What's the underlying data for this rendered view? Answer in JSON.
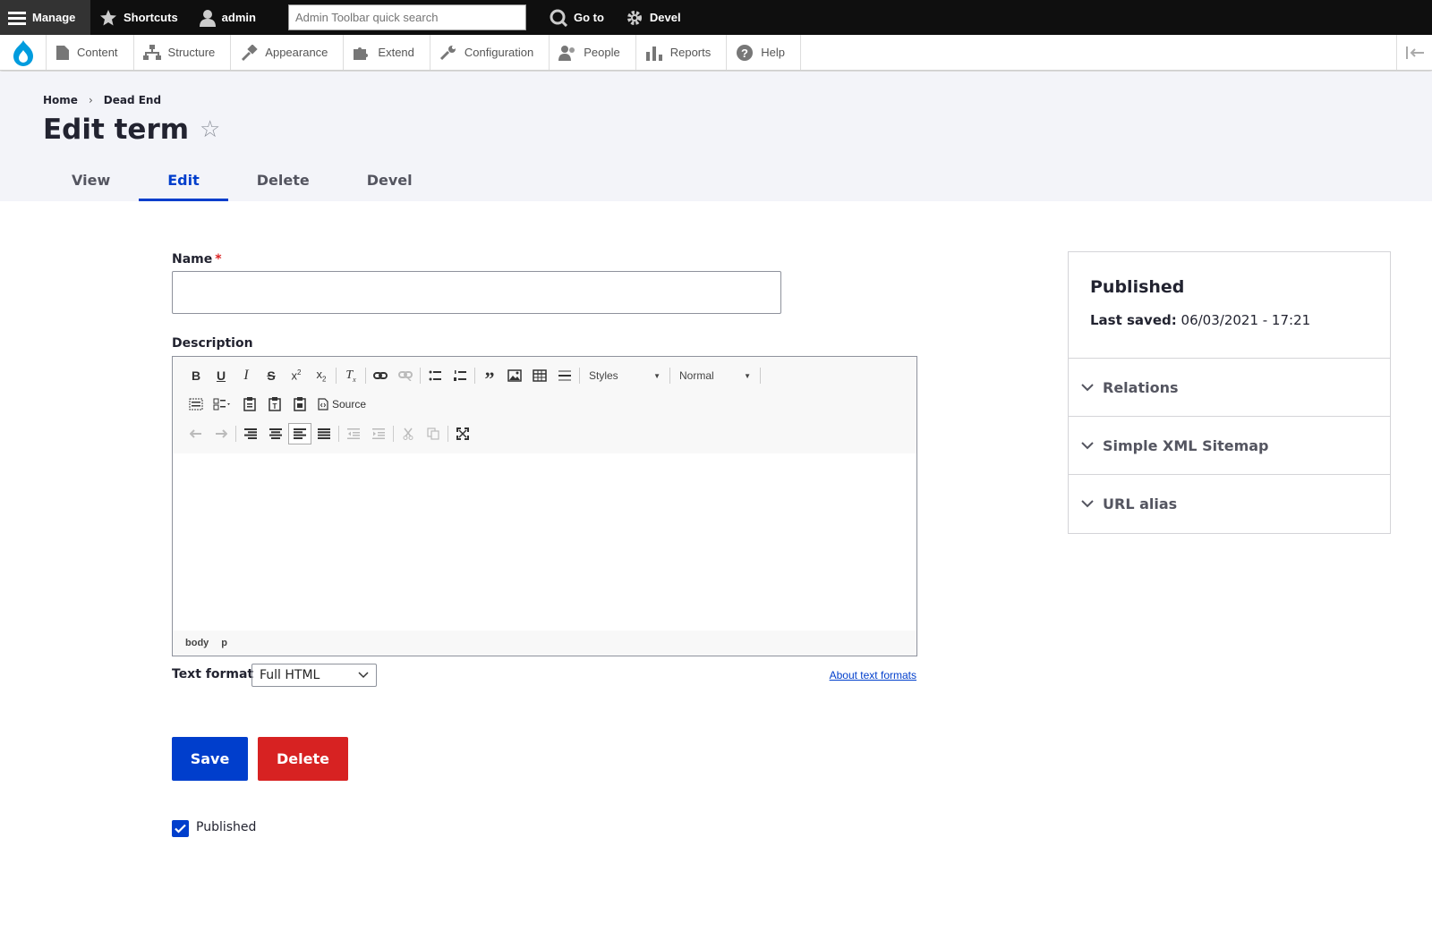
{
  "toolbar": {
    "manage_label": "Manage",
    "shortcuts_label": "Shortcuts",
    "user_label": "admin",
    "search_placeholder": "Admin Toolbar quick search",
    "goto_label": "Go to",
    "devel_label": "Devel"
  },
  "tray": {
    "items": [
      {
        "label": "Content",
        "icon": "content-icon"
      },
      {
        "label": "Structure",
        "icon": "structure-icon"
      },
      {
        "label": "Appearance",
        "icon": "appearance-icon"
      },
      {
        "label": "Extend",
        "icon": "extend-icon"
      },
      {
        "label": "Configuration",
        "icon": "configuration-icon"
      },
      {
        "label": "People",
        "icon": "people-icon"
      },
      {
        "label": "Reports",
        "icon": "reports-icon"
      },
      {
        "label": "Help",
        "icon": "help-icon"
      }
    ]
  },
  "breadcrumb": {
    "home": "Home",
    "sep": "›",
    "current": "Dead End"
  },
  "page": {
    "title": "Edit term",
    "star": "☆"
  },
  "tabs": [
    {
      "label": "View",
      "active": false
    },
    {
      "label": "Edit",
      "active": true
    },
    {
      "label": "Delete",
      "active": false
    },
    {
      "label": "Devel",
      "active": false
    }
  ],
  "form": {
    "name_label": "Name",
    "required_marker": "*",
    "name_value": "",
    "description_label": "Description",
    "editor": {
      "styles_label": "Styles",
      "format_label": "Normal",
      "source_label": "Source",
      "path": [
        "body",
        "p"
      ]
    },
    "text_format_label": "Text format",
    "text_format_value": "Full HTML",
    "about_link": "About text formats",
    "save_label": "Save",
    "delete_label": "Delete",
    "published_label": "Published",
    "published_checked": true
  },
  "sidebar": {
    "status": "Published",
    "last_saved_label": "Last saved:",
    "last_saved_value": "06/03/2021 - 17:21",
    "sections": [
      "Relations",
      "Simple XML Sitemap",
      "URL alias"
    ]
  },
  "colors": {
    "accent": "#003ecc",
    "danger": "#d72222",
    "toolbar_bg": "#0f0f0f",
    "header_bg": "#f3f4f9"
  }
}
